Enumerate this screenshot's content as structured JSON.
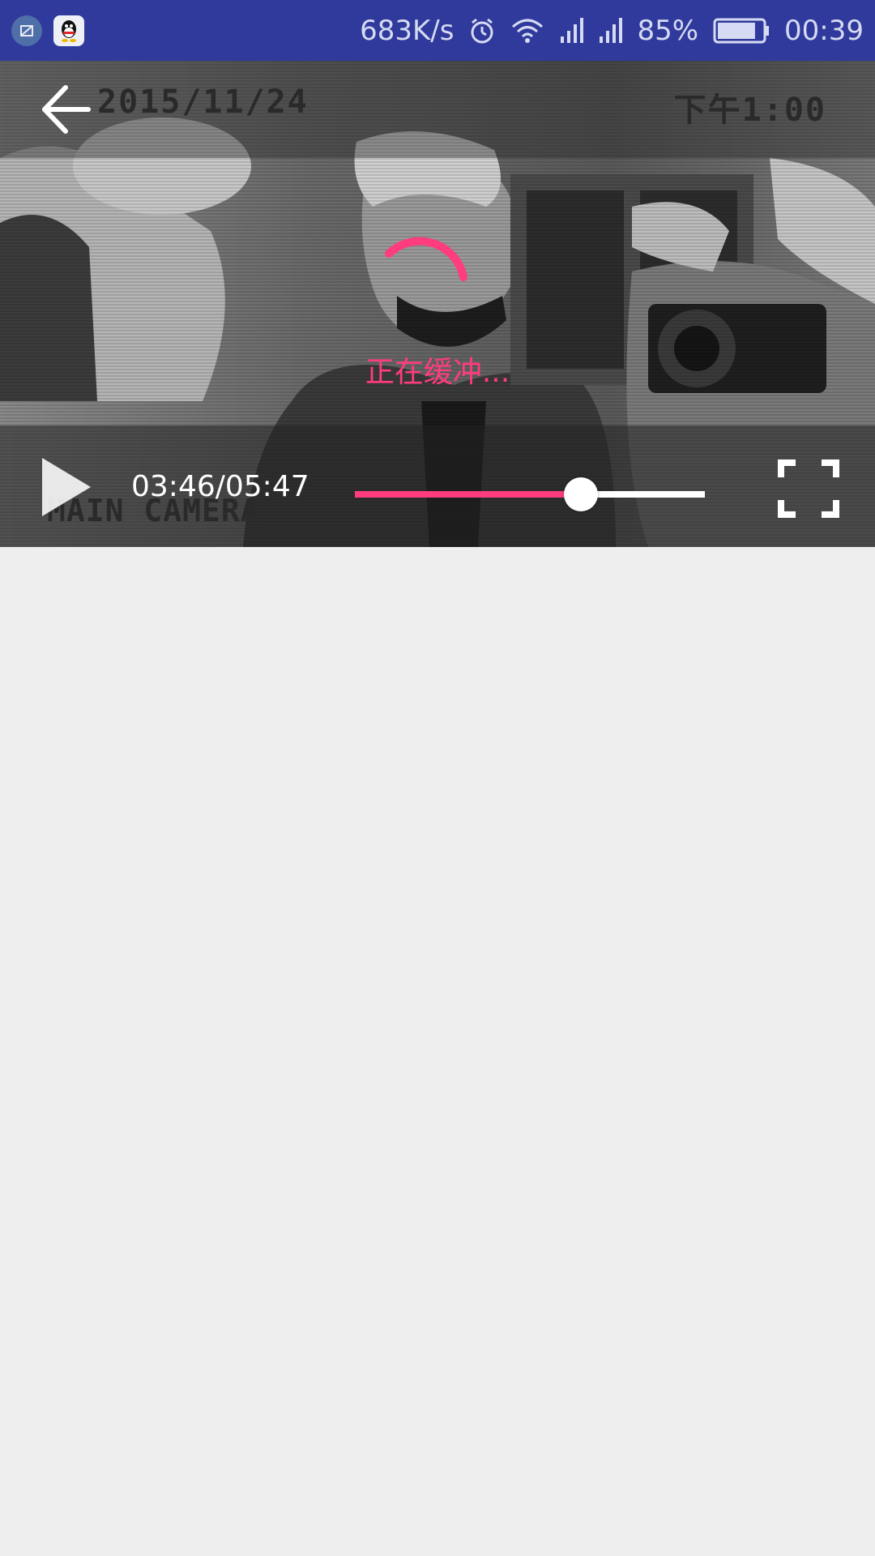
{
  "status_bar": {
    "network_speed": "683K/s",
    "battery_percent": "85%",
    "battery_level": 0.85,
    "clock": "00:39",
    "icons": [
      "screenshot-app-icon",
      "qq-icon",
      "alarm-icon",
      "wifi-icon",
      "signal-icon",
      "signal-icon",
      "battery-icon"
    ]
  },
  "player": {
    "osd_date": "2015/11/24",
    "osd_time": "下午1:00",
    "osd_camera": "MAIN CAMERA",
    "buffering_text": "正在缓冲...",
    "time": "03:46/05:47",
    "progress": 0.646,
    "accent_color": "#ff3c7d",
    "icons": [
      "back-arrow-icon",
      "play-icon",
      "fullscreen-icon",
      "loading-spinner-icon"
    ]
  }
}
